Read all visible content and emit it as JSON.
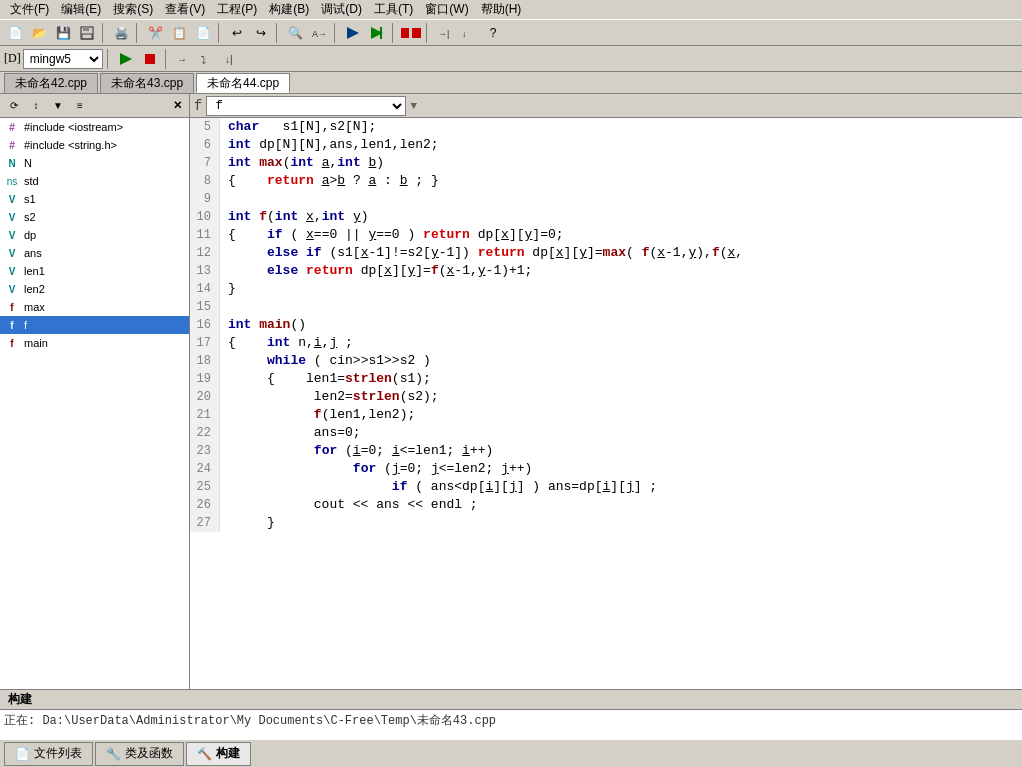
{
  "menubar": {
    "items": [
      "文件(F)",
      "编辑(E)",
      "搜索(S)",
      "查看(V)",
      "工程(P)",
      "构建(B)",
      "调试(D)",
      "工具(T)",
      "窗口(W)",
      "帮助(H)"
    ]
  },
  "toolbar": {
    "buttons": [
      "📄",
      "📂",
      "💾",
      "🖨️",
      "✂️",
      "📋",
      "📄",
      "↩️",
      "↪️",
      "🔍",
      "🔍",
      "⚙️",
      "🔨",
      "▶️",
      "⏹️",
      "➡️",
      "🐛",
      "🔎"
    ]
  },
  "debug_select": "mingw5",
  "tabs": [
    {
      "label": "未命名42.cpp",
      "active": false
    },
    {
      "label": "未命名43.cpp",
      "active": false
    },
    {
      "label": "未命名44.cpp",
      "active": true
    }
  ],
  "func_select": "f",
  "left_panel": {
    "items": [
      {
        "label": "#include <iostream>",
        "indent": 0,
        "type": "include",
        "icon": "📄"
      },
      {
        "label": "#include <string.h>",
        "indent": 0,
        "type": "include",
        "icon": "📄"
      },
      {
        "label": "N",
        "indent": 0,
        "type": "var",
        "icon": "N"
      },
      {
        "label": "std",
        "indent": 0,
        "type": "ns",
        "icon": "ns"
      },
      {
        "label": "s1",
        "indent": 0,
        "type": "var",
        "icon": "V"
      },
      {
        "label": "s2",
        "indent": 0,
        "type": "var",
        "icon": "V"
      },
      {
        "label": "dp",
        "indent": 0,
        "type": "var",
        "icon": "V"
      },
      {
        "label": "ans",
        "indent": 0,
        "type": "var",
        "icon": "V"
      },
      {
        "label": "len1",
        "indent": 0,
        "type": "var",
        "icon": "V"
      },
      {
        "label": "len2",
        "indent": 0,
        "type": "var",
        "icon": "V"
      },
      {
        "label": "max",
        "indent": 0,
        "type": "func",
        "icon": "f"
      },
      {
        "label": "f",
        "indent": 0,
        "type": "func",
        "icon": "f",
        "selected": true
      },
      {
        "label": "main",
        "indent": 0,
        "type": "func",
        "icon": "f"
      }
    ]
  },
  "code_lines": [
    {
      "num": 5,
      "content": "char   s1[N],s2[N];"
    },
    {
      "num": 6,
      "content": "int dp[N][N],ans,len1,len2;"
    },
    {
      "num": 7,
      "content": "int max(int a,int b)"
    },
    {
      "num": 8,
      "content": "{    return a>b ? a : b ; }"
    },
    {
      "num": 9,
      "content": ""
    },
    {
      "num": 10,
      "content": "int f(int x,int y)"
    },
    {
      "num": 11,
      "content": "{    if ( x==0 || y==0 ) return dp[x][y]=0;"
    },
    {
      "num": 12,
      "content": "     else if (s1[x-1]!=s2[y-1]) return dp[x][y]=max( f(x-1,y),f(x,"
    },
    {
      "num": 13,
      "content": "     else return dp[x][y]=f(x-1,y-1)+1;"
    },
    {
      "num": 14,
      "content": "}"
    },
    {
      "num": 15,
      "content": ""
    },
    {
      "num": 16,
      "content": "int main()"
    },
    {
      "num": 17,
      "content": "{    int n,i,j ;"
    },
    {
      "num": 18,
      "content": "     while ( cin>>s1>>s2 )"
    },
    {
      "num": 19,
      "content": "     {    len1=strlen(s1);"
    },
    {
      "num": 20,
      "content": "           len2=strlen(s2);"
    },
    {
      "num": 21,
      "content": "           f(len1,len2);"
    },
    {
      "num": 22,
      "content": "           ans=0;"
    },
    {
      "num": 23,
      "content": "           for (i=0; i<=len1; i++)"
    },
    {
      "num": 24,
      "content": "                for (j=0; j<=len2; j++)"
    },
    {
      "num": 25,
      "content": "                     if ( ans<dp[i][j] ) ans=dp[i][j] ;"
    },
    {
      "num": 26,
      "content": "           cout << ans << endl ;"
    },
    {
      "num": 27,
      "content": "     }"
    }
  ],
  "build": {
    "header": "构建",
    "content": "正在: Da:\\UserData\\Administrator\\My Documents\\C-Free\\Temp\\未命名43.cpp"
  },
  "bottom_tabs": [
    {
      "label": "文件列表",
      "active": false
    },
    {
      "label": "类及函数",
      "active": false
    },
    {
      "label": "构建",
      "active": true
    }
  ]
}
